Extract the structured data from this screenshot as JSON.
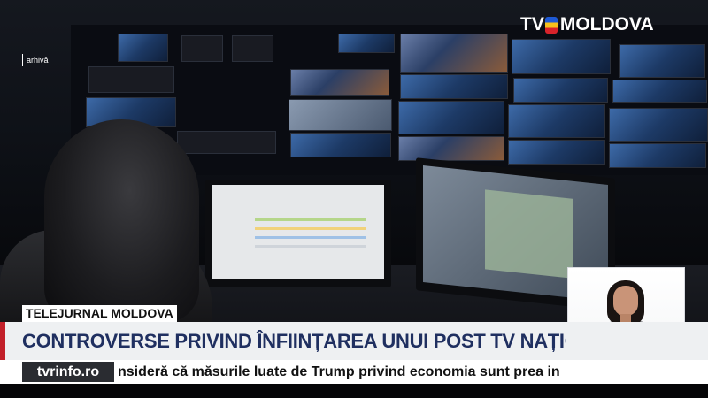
{
  "channel": {
    "logo_prefix": "TV",
    "logo_name": "MOLDOVA",
    "brand_colors": {
      "blue": "#1e5ad6",
      "yellow": "#f6c21c",
      "red": "#d8232a"
    }
  },
  "overlay": {
    "archive_label": "arhivă"
  },
  "lower_third": {
    "program": "TELEJURNAL MOLDOVA",
    "headline": "CONTROVERSE PRIVIND ÎNFIINȚAREA UNUI POST TV NAȚIONAL ÎN LIMBA RUSĂ",
    "site": "tvrinfo.ro",
    "ticker": "nsideră că măsurile luate de Trump privind economia sunt prea in",
    "headline_color": "#1f2f60"
  },
  "sign_language": {
    "icon": "hearing-impaired-icon"
  }
}
